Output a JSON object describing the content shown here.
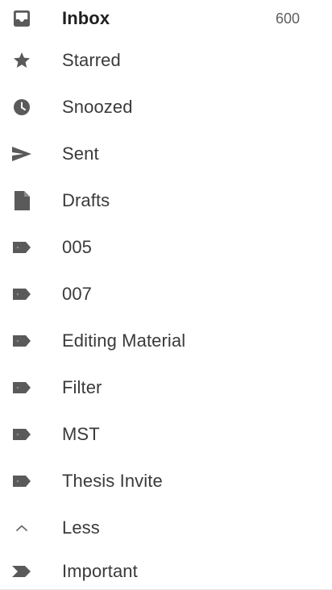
{
  "drawer": {
    "items": [
      {
        "label": "Inbox",
        "count": "600",
        "icon": "inbox-icon"
      },
      {
        "label": "Starred",
        "icon": "star-icon"
      },
      {
        "label": "Snoozed",
        "icon": "clock-icon"
      },
      {
        "label": "Sent",
        "icon": "send-icon"
      },
      {
        "label": "Drafts",
        "icon": "draft-icon"
      },
      {
        "label": "005",
        "icon": "label-icon"
      },
      {
        "label": "007",
        "icon": "label-icon"
      },
      {
        "label": "Editing Material",
        "icon": "label-icon"
      },
      {
        "label": "Filter",
        "icon": "label-icon"
      },
      {
        "label": "MST",
        "icon": "label-icon"
      },
      {
        "label": "Thesis Invite",
        "icon": "label-icon"
      },
      {
        "label": "Less",
        "icon": "chevron-up-icon"
      },
      {
        "label": "Important",
        "icon": "important-icon"
      }
    ]
  },
  "colors": {
    "icon": "#5a5a5a",
    "text": "#3a3a3a",
    "background": "#ffffff"
  }
}
